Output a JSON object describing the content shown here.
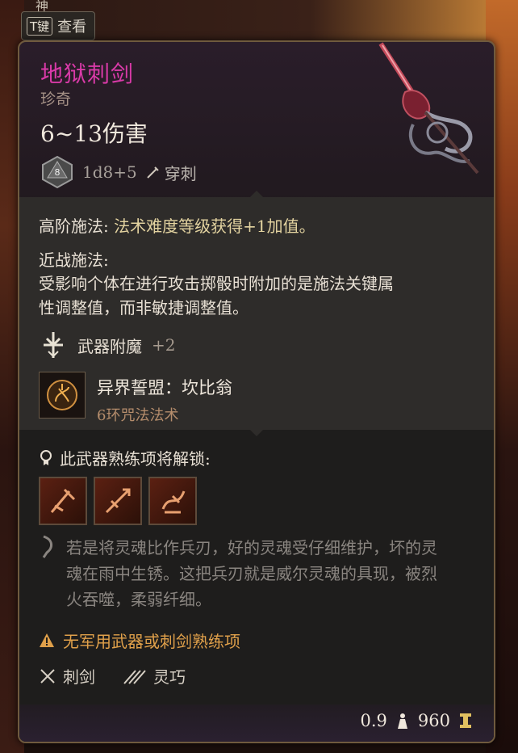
{
  "background": {
    "top_partial_text": "神"
  },
  "key_hint": {
    "key": "T键",
    "label": "查看"
  },
  "item": {
    "name": "地狱刺剑",
    "rarity": "珍奇",
    "damage": "6~13伤害",
    "die_face": "8",
    "dice": "1d8+5",
    "damage_type": "穿刺"
  },
  "properties": {
    "superior_spell_title": "高阶施法:",
    "superior_spell_desc": "法术难度等级获得+1加值。",
    "melee_spell_title": "近战施法:",
    "melee_spell_desc_line1": "受影响个体在进行攻击掷骰时附加的是施法关键属",
    "melee_spell_desc_line2": "性调整值，而非敏捷调整值。",
    "enchant_label": "武器附魔",
    "enchant_bonus": "+2",
    "spell_name": "异界誓盟：坎比翁",
    "spell_level": "6环咒法法术"
  },
  "proficiency": {
    "unlock_label": "此武器熟练项将解锁:",
    "actions": [
      "action-1",
      "action-2",
      "action-3"
    ]
  },
  "flavor": {
    "line1": "若是将灵魂比作兵刃，好的灵魂受仔细维护，坏的灵",
    "line2": "魂在雨中生锈。这把兵刃就是威尔灵魂的具现，被烈",
    "line3": "火吞噬，柔弱纤细。"
  },
  "warning": "无军用武器或刺剑熟练项",
  "weapon_props": {
    "type": "刺剑",
    "property": "灵巧"
  },
  "footer": {
    "weight": "0.9",
    "value": "960"
  },
  "colors": {
    "title": "#d93aa8",
    "warning": "#e0a04a",
    "accent": "#e3d3a0",
    "spell_sub": "#b58d6c"
  }
}
